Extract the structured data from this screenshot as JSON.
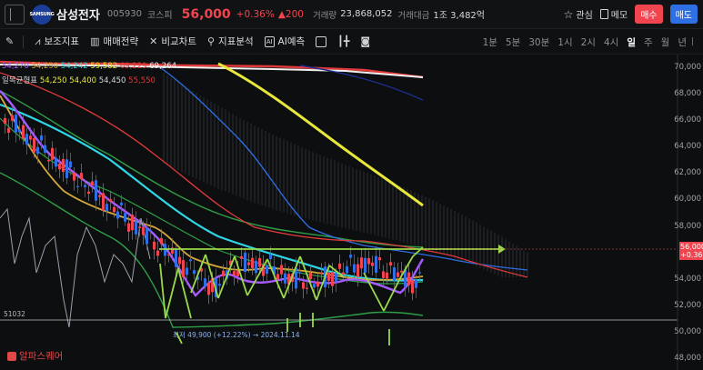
{
  "header": {
    "logo_text": "SAMSUNG",
    "stock_name": "삼성전자",
    "stock_code": "005930",
    "market": "코스피",
    "price": "56,000",
    "change_pct": "+0.36%",
    "change_amt": "▲200",
    "volume_label": "거래량",
    "volume_value": "23,868,052",
    "amount_label": "거래대금",
    "amount_value": "1조 3,482억",
    "watch_label": "관심",
    "memo_label": "메모",
    "buy_label": "매수",
    "sell_label": "매도"
  },
  "toolbar": {
    "items": [
      "보조지표",
      "매매전략",
      "비교차트",
      "지표분석",
      "AI예측"
    ],
    "periods": [
      "1분",
      "5분",
      "30분",
      "1시",
      "2시",
      "4시",
      "일",
      "주",
      "월",
      "년"
    ],
    "active_period": "일"
  },
  "legend": {
    "line1_values": [
      "54,270",
      "54,290",
      "54,242",
      "59,582",
      "69,229",
      "69,264"
    ],
    "line2_name": "일목균형표",
    "line2_values": [
      "54,250",
      "54,400",
      "54,450",
      "55,550"
    ]
  },
  "axis": {
    "ticks": [
      "70,000",
      "68,000",
      "66,000",
      "64,000",
      "62,000",
      "60,000",
      "58,000",
      "54,000",
      "52,000",
      "50,000",
      "48,000"
    ],
    "current_price": "56,000",
    "current_change": "+0.36%"
  },
  "annotations": {
    "low_text": "최저 49,900 (+12.22%) → 2024.11.14",
    "support_value": "51032"
  },
  "watermark": "알파스퀘어",
  "colors": {
    "up": "#f0454f",
    "down": "#2f6fe4",
    "ma_yellow": "#e8e83a",
    "ma_cyan": "#2fd6e6",
    "ma_purple": "#a85cff",
    "ma_gold": "#d4a83a",
    "bollinger": "#2e9e46",
    "arrow": "#9ad94a"
  }
}
